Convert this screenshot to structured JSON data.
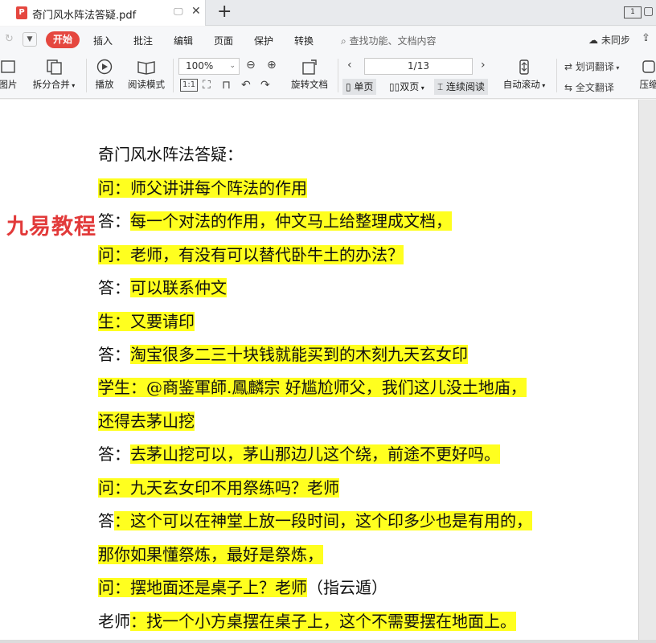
{
  "tab": {
    "title": "奇门风水阵法答疑.pdf",
    "icon": "pdf-icon",
    "add": "+"
  },
  "menu": {
    "start": "开始",
    "items": [
      "插入",
      "批注",
      "编辑",
      "页面",
      "保护",
      "转换"
    ],
    "search": "查找功能、文档内容",
    "sync": "未同步"
  },
  "toolbar": {
    "image": "图片",
    "split_merge": "拆分合并",
    "play": "播放",
    "read_mode": "阅读模式",
    "zoom": "100%",
    "rotate": "旋转文档",
    "page": "1/13",
    "single": "单页",
    "double": "双页",
    "continuous": "连续阅读",
    "auto_scroll": "自动滚动",
    "word_translate": "划词翻译",
    "full_translate": "全文翻译",
    "compress": "压缩"
  },
  "watermark": "九易教程",
  "document": {
    "lines": [
      {
        "prefix": "奇门风水阵法答疑：",
        "text": ""
      },
      {
        "prefix": "",
        "text": "问：师父讲讲每个阵法的作用"
      },
      {
        "prefix": "答：",
        "text": "每一个对法的作用，仲文马上给整理成文档，"
      },
      {
        "prefix": "",
        "text": "问：老师，有没有可以替代卧牛土的办法？"
      },
      {
        "prefix": "答：",
        "text": "可以联系仲文"
      },
      {
        "prefix": "",
        "text": "生：又要请印"
      },
      {
        "prefix": "答：",
        "text": "淘宝很多二三十块钱就能买到的木刻九天玄女印"
      },
      {
        "prefix": "",
        "text": "学生：@商鉴軍師.鳳麟宗 好尴尬师父，我们这儿没土地庙，"
      },
      {
        "prefix": "",
        "text": "还得去茅山挖"
      },
      {
        "prefix": "答：",
        "text": "去茅山挖可以，茅山那边儿这个绕，前途不更好吗。"
      },
      {
        "prefix": "",
        "text": "问：九天玄女印不用祭练吗？老师"
      },
      {
        "prefix": "答",
        "text": "：这个可以在神堂上放一段时间，这个印多少也是有用的，"
      },
      {
        "prefix": "",
        "text": "那你如果懂祭炼，最好是祭炼，"
      },
      {
        "prefix": "",
        "text": "问：摆地面还是桌子上？老师",
        "suffix": "（指云遁）"
      },
      {
        "prefix": "老师",
        "text": "：找一个小方桌摆在桌子上，这个不需要摆在地面上。"
      }
    ]
  }
}
